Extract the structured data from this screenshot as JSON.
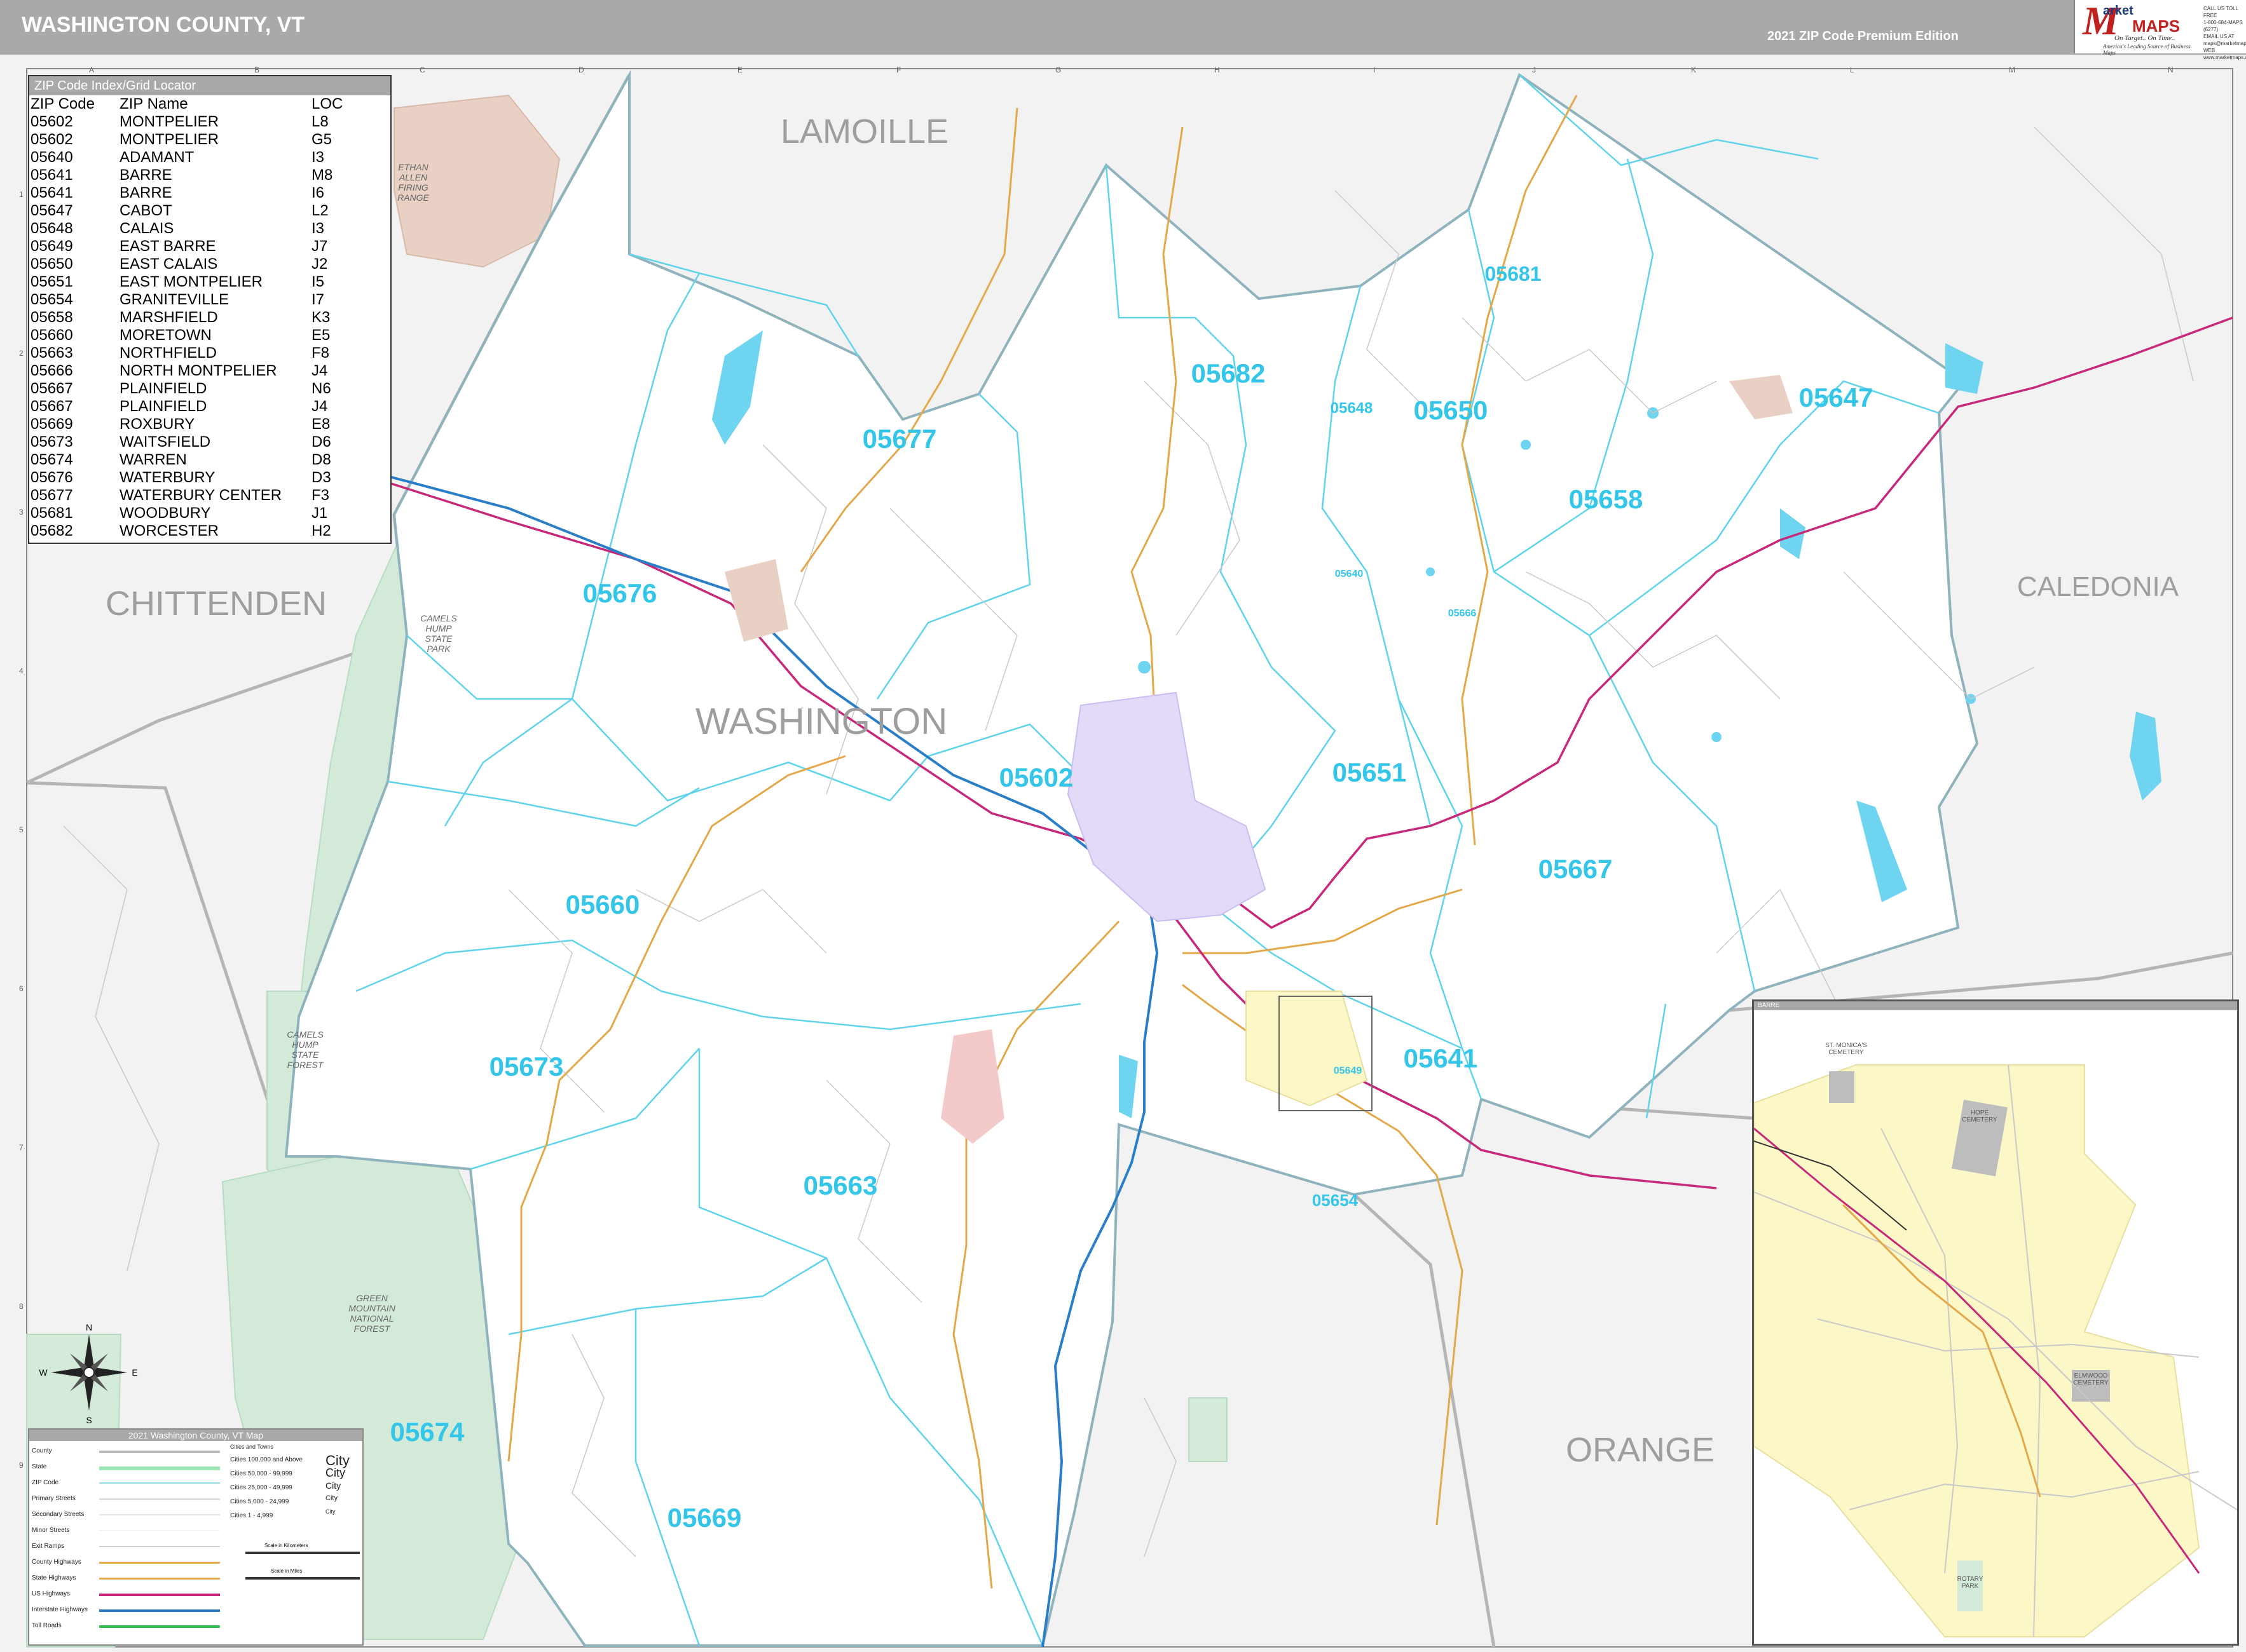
{
  "header": {
    "title": "WASHINGTON COUNTY, VT",
    "edition": "2021 ZIP Code Premium Edition",
    "logo_name": "arket",
    "logo_maps": "MAPS",
    "logo_tagline": "On Target.. On Time..",
    "logo_subtagline": "America's Leading Source of Business Maps",
    "contact_lines": [
      "CALL US TOLL FREE",
      "1-800-684-MAPS (6277)",
      "EMAIL US AT",
      "maps@marketmaps.com",
      "WEB",
      "www.marketmaps.com"
    ]
  },
  "grid": {
    "columns": [
      "A",
      "B",
      "C",
      "D",
      "E",
      "F",
      "G",
      "H",
      "I",
      "J",
      "K",
      "L",
      "M",
      "N"
    ],
    "rows": [
      "1",
      "2",
      "3",
      "4",
      "5",
      "6",
      "7",
      "8",
      "9"
    ]
  },
  "zip_index": {
    "title": "ZIP Code Index/Grid Locator",
    "headers": [
      "ZIP Code",
      "ZIP Name",
      "LOC"
    ],
    "rows": [
      [
        "05602",
        "MONTPELIER",
        "L8"
      ],
      [
        "05602",
        "MONTPELIER",
        "G5"
      ],
      [
        "05640",
        "ADAMANT",
        "I3"
      ],
      [
        "05641",
        "BARRE",
        "M8"
      ],
      [
        "05641",
        "BARRE",
        "I6"
      ],
      [
        "05647",
        "CABOT",
        "L2"
      ],
      [
        "05648",
        "CALAIS",
        "I3"
      ],
      [
        "05649",
        "EAST BARRE",
        "J7"
      ],
      [
        "05650",
        "EAST CALAIS",
        "J2"
      ],
      [
        "05651",
        "EAST MONTPELIER",
        "I5"
      ],
      [
        "05654",
        "GRANITEVILLE",
        "I7"
      ],
      [
        "05658",
        "MARSHFIELD",
        "K3"
      ],
      [
        "05660",
        "MORETOWN",
        "E5"
      ],
      [
        "05663",
        "NORTHFIELD",
        "F8"
      ],
      [
        "05666",
        "NORTH MONTPELIER",
        "J4"
      ],
      [
        "05667",
        "PLAINFIELD",
        "N6"
      ],
      [
        "05667",
        "PLAINFIELD",
        "J4"
      ],
      [
        "05669",
        "ROXBURY",
        "E8"
      ],
      [
        "05673",
        "WAITSFIELD",
        "D6"
      ],
      [
        "05674",
        "WARREN",
        "D8"
      ],
      [
        "05676",
        "WATERBURY",
        "D3"
      ],
      [
        "05677",
        "WATERBURY CENTER",
        "F3"
      ],
      [
        "05681",
        "WOODBURY",
        "J1"
      ],
      [
        "05682",
        "WORCESTER",
        "H2"
      ]
    ]
  },
  "counties": {
    "main": "WASHINGTON",
    "neighbors": [
      "LAMOILLE",
      "CHITTENDEN",
      "CALEDONIA",
      "ORANGE"
    ]
  },
  "zip_labels": [
    "05677",
    "05682",
    "05681",
    "05648",
    "05650",
    "05647",
    "05658",
    "05676",
    "05602",
    "05651",
    "05660",
    "05667",
    "05673",
    "05641",
    "05663",
    "05654",
    "05674",
    "05669",
    "05640",
    "05666",
    "05649"
  ],
  "parks": {
    "ethan_allen": "ETHAN ALLEN FIRING RANGE",
    "camels_hump_park": "CAMELS HUMP STATE PARK",
    "camels_hump_forest": "CAMELS HUMP STATE FOREST",
    "green_mountain": "GREEN MOUNTAIN NATIONAL FOREST",
    "inset_cemeteries": [
      "ST. MONICA'S CEMETERY",
      "HOPE CEMETERY",
      "ELMWOOD CEMETERY",
      "ROTARY PARK"
    ]
  },
  "compass": {
    "n": "N",
    "s": "S",
    "e": "E",
    "w": "W"
  },
  "legend": {
    "title": "2021 Washington County, VT Map",
    "items": [
      "County",
      "State",
      "ZIP Code",
      "Primary Streets",
      "Secondary Streets",
      "Minor Streets",
      "Exit Ramps",
      "County Highways",
      "State Highways",
      "US Highways",
      "Interstate Highways",
      "Toll Roads"
    ],
    "cities_header": "Cities and Towns",
    "cities": [
      "Cities 100,000 and Above",
      "Cities 50,000 - 99,999",
      "Cities 25,000 - 49,999",
      "Cities 5,000 - 24,999",
      "Cities 1 - 4,999"
    ],
    "city_symbols": [
      "City",
      "City",
      "City",
      "City",
      "City"
    ],
    "scale_km": "Scale in Kilometers",
    "scale_mi": "Scale in Miles"
  },
  "inset": {
    "title": "BARRE"
  },
  "colors": {
    "zip_label": "#34c6e8",
    "zip_boundary": "#5fd3ea",
    "county_boundary": "#8fb3bd",
    "interstate": "#2a7ec8",
    "us_highway": "#c8287a",
    "state_highway": "#e2a84a",
    "park": "#d4ead9",
    "water": "#6fd4ef",
    "city": "#e8d0c4",
    "montpelier": "#e3daf7",
    "inset_city": "#fbf7c6"
  }
}
